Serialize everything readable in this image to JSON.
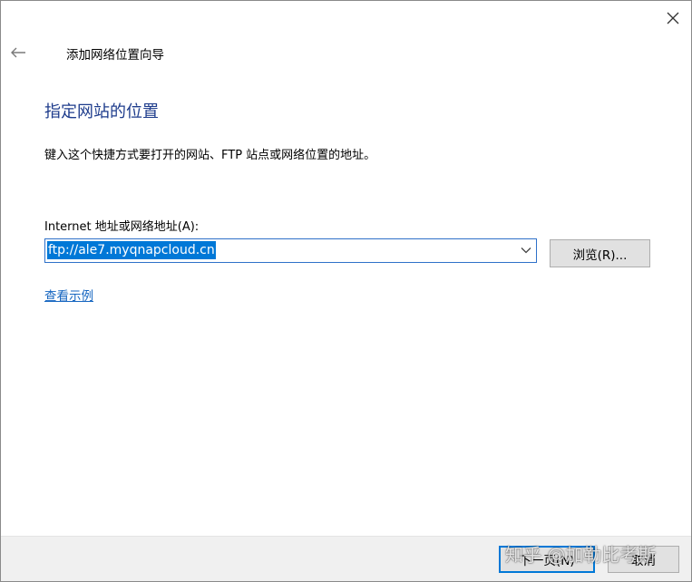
{
  "wizard": {
    "title": "添加网络位置向导",
    "heading": "指定网站的位置",
    "description": "键入这个快捷方式要打开的网站、FTP 站点或网络位置的地址。"
  },
  "address": {
    "label": "Internet 地址或网络地址(A):",
    "value": "ftp://ale7.myqnapcloud.cn"
  },
  "buttons": {
    "browse": "浏览(R)...",
    "next": "下一页(N)",
    "cancel": "取消"
  },
  "links": {
    "example": "查看示例"
  },
  "watermark": {
    "text": "知乎 @加勒比考斯"
  },
  "icons": {
    "close": "close-icon",
    "back": "back-arrow-icon",
    "dropdown": "chevron-down-icon"
  },
  "colors": {
    "heading": "#1e3c8c",
    "selection": "#0078d7",
    "link": "#1565c0",
    "footer": "#f0f0f0"
  }
}
